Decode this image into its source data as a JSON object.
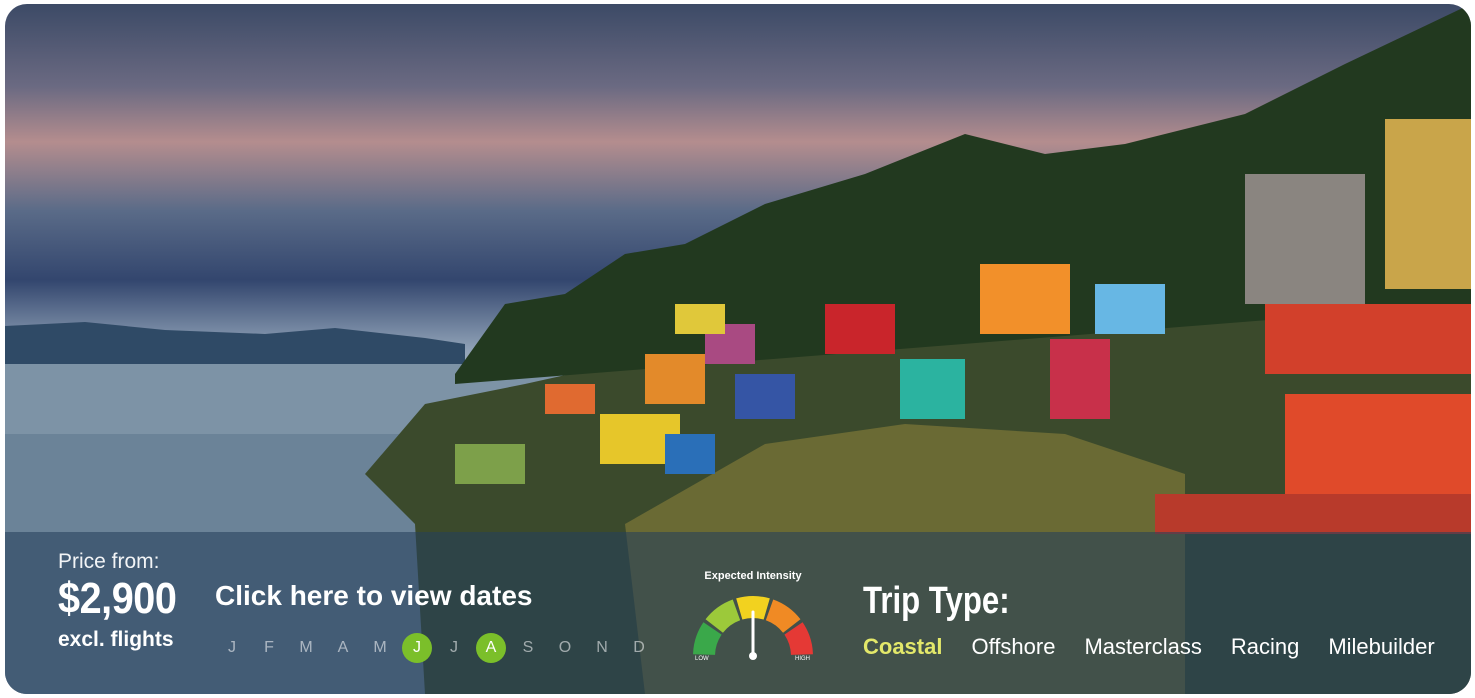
{
  "hero": {
    "price_label": "Price from:",
    "price_value": "$2,900",
    "price_note": "excl. flights",
    "dates_link": "Click here to view dates"
  },
  "months": [
    {
      "label": "J",
      "active": false
    },
    {
      "label": "F",
      "active": false
    },
    {
      "label": "M",
      "active": false
    },
    {
      "label": "A",
      "active": false
    },
    {
      "label": "M",
      "active": false
    },
    {
      "label": "J",
      "active": true
    },
    {
      "label": "J",
      "active": false
    },
    {
      "label": "A",
      "active": true
    },
    {
      "label": "S",
      "active": false
    },
    {
      "label": "O",
      "active": false
    },
    {
      "label": "N",
      "active": false
    },
    {
      "label": "D",
      "active": false
    }
  ],
  "intensity": {
    "title": "Expected Intensity",
    "low_label": "LOW",
    "high_label": "HIGH",
    "level": 0.5,
    "colors": [
      "#3aa84a",
      "#9cc93a",
      "#f2d21f",
      "#f08a24",
      "#e53935"
    ]
  },
  "trip": {
    "title": "Trip Type:",
    "types": [
      {
        "label": "Coastal",
        "selected": true
      },
      {
        "label": "Offshore",
        "selected": false
      },
      {
        "label": "Masterclass",
        "selected": false
      },
      {
        "label": "Racing",
        "selected": false
      },
      {
        "label": "Milebuilder",
        "selected": false
      }
    ],
    "selected_color": "#e3e86a"
  },
  "accent_active_month": "#7bbf2a"
}
